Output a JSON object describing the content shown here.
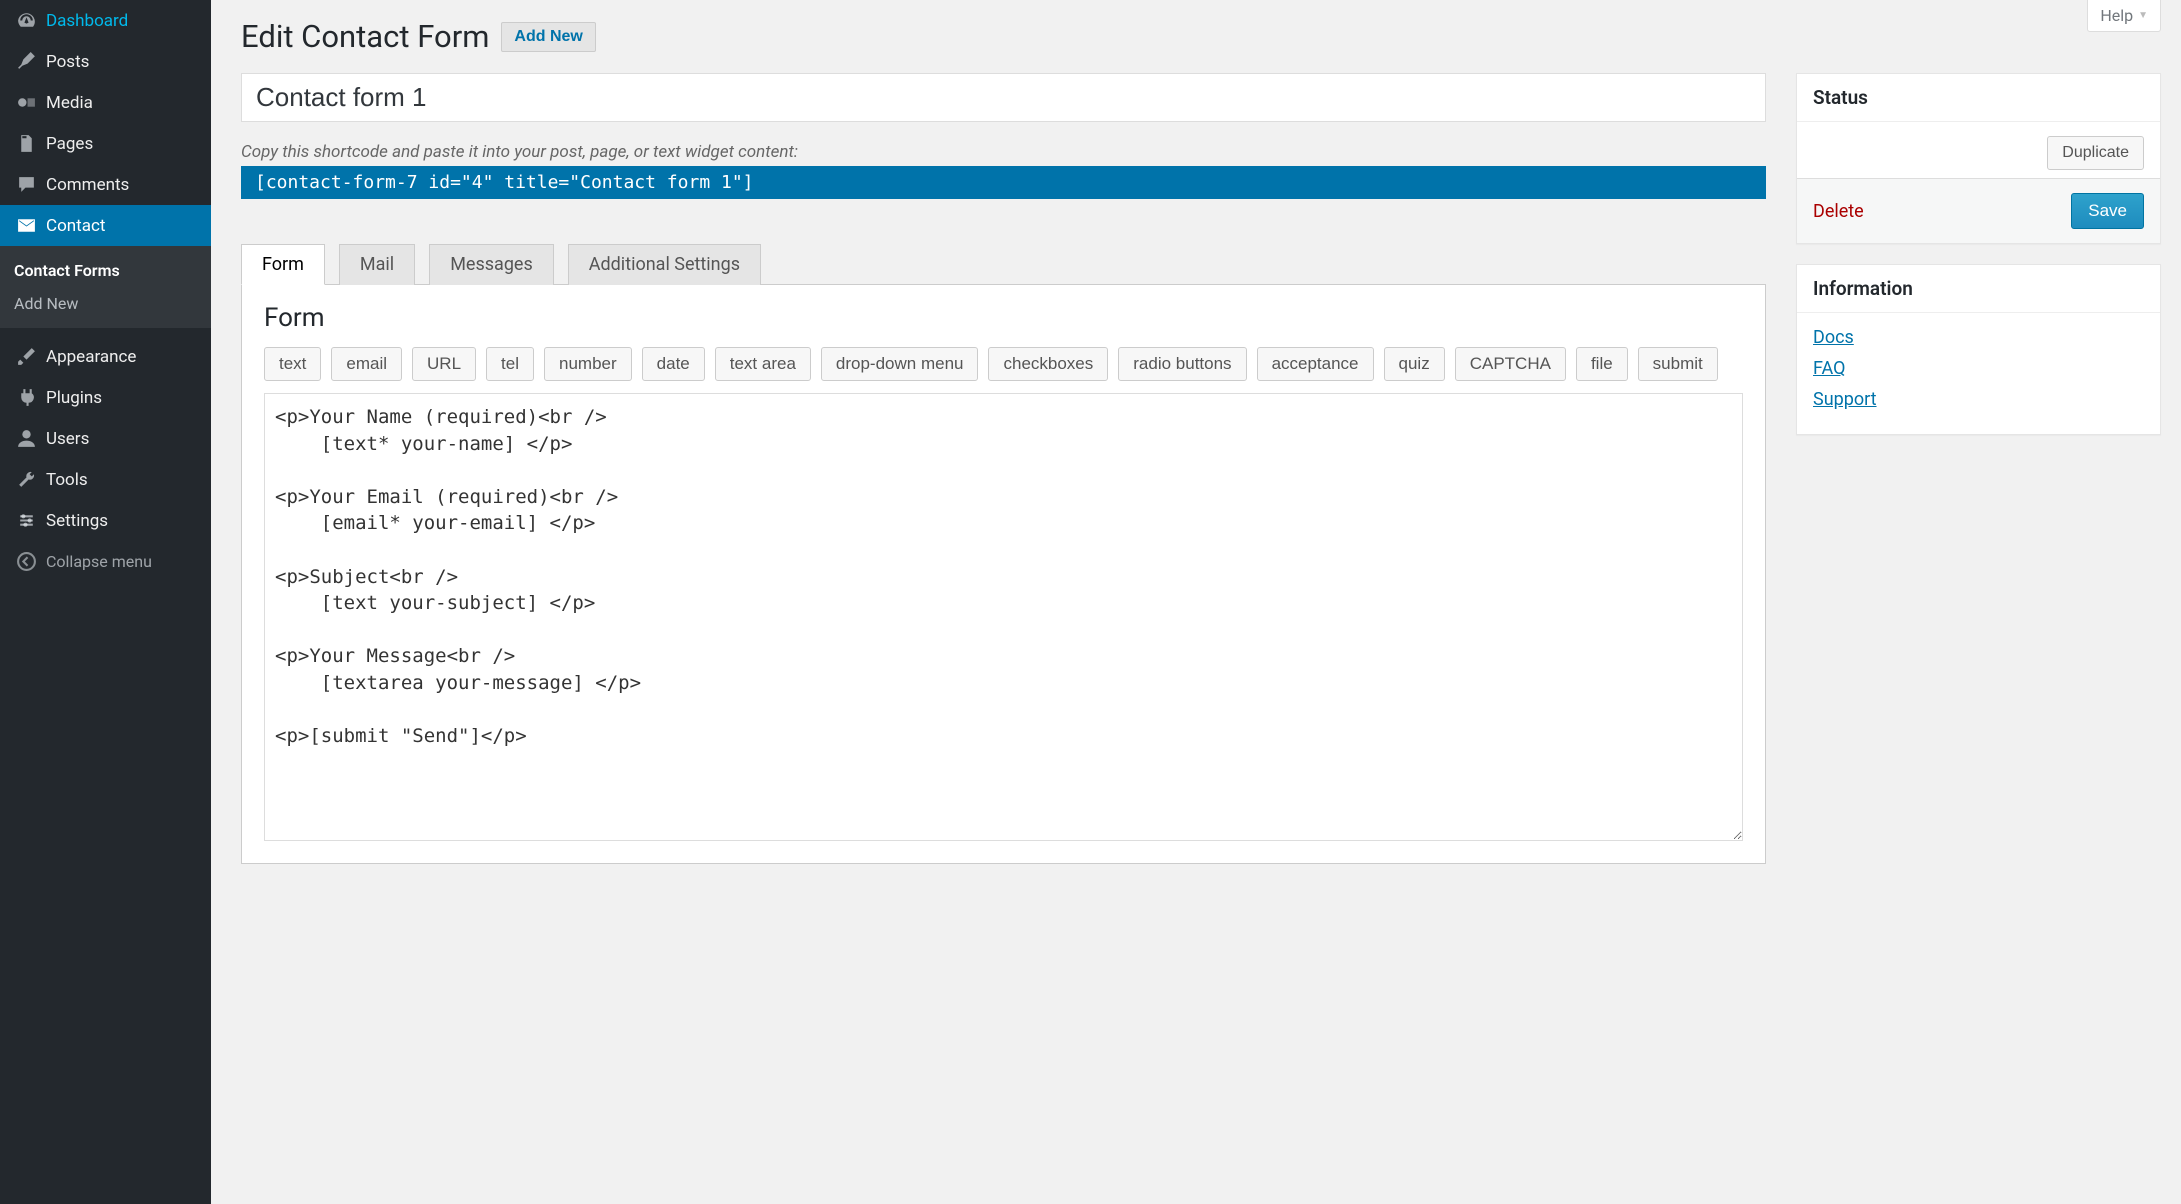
{
  "sidebar": {
    "items": [
      {
        "label": "Dashboard",
        "icon": "dashboard"
      },
      {
        "label": "Posts",
        "icon": "pin"
      },
      {
        "label": "Media",
        "icon": "media"
      },
      {
        "label": "Pages",
        "icon": "pages"
      },
      {
        "label": "Comments",
        "icon": "comment"
      },
      {
        "label": "Contact",
        "icon": "mail",
        "current": true
      },
      {
        "label": "Appearance",
        "icon": "brush"
      },
      {
        "label": "Plugins",
        "icon": "plug"
      },
      {
        "label": "Users",
        "icon": "user"
      },
      {
        "label": "Tools",
        "icon": "wrench"
      },
      {
        "label": "Settings",
        "icon": "settings"
      }
    ],
    "submenu": [
      {
        "label": "Contact Forms",
        "active": true
      },
      {
        "label": "Add New"
      }
    ],
    "collapse": "Collapse menu"
  },
  "header": {
    "title": "Edit Contact Form",
    "add_new": "Add New",
    "help": "Help"
  },
  "form": {
    "title_value": "Contact form 1",
    "shortcode_help": "Copy this shortcode and paste it into your post, page, or text widget content:",
    "shortcode_value": "[contact-form-7 id=\"4\" title=\"Contact form 1\"]"
  },
  "tabs": [
    "Form",
    "Mail",
    "Messages",
    "Additional Settings"
  ],
  "panel": {
    "heading": "Form",
    "tag_buttons": [
      "text",
      "email",
      "URL",
      "tel",
      "number",
      "date",
      "text area",
      "drop-down menu",
      "checkboxes",
      "radio buttons",
      "acceptance",
      "quiz",
      "CAPTCHA",
      "file",
      "submit"
    ],
    "textarea": "<p>Your Name (required)<br />\n    [text* your-name] </p>\n\n<p>Your Email (required)<br />\n    [email* your-email] </p>\n\n<p>Subject<br />\n    [text your-subject] </p>\n\n<p>Your Message<br />\n    [textarea your-message] </p>\n\n<p>[submit \"Send\"]</p>"
  },
  "status_box": {
    "title": "Status",
    "duplicate": "Duplicate",
    "delete": "Delete",
    "save": "Save"
  },
  "info_box": {
    "title": "Information",
    "links": [
      "Docs",
      "FAQ",
      "Support"
    ]
  }
}
